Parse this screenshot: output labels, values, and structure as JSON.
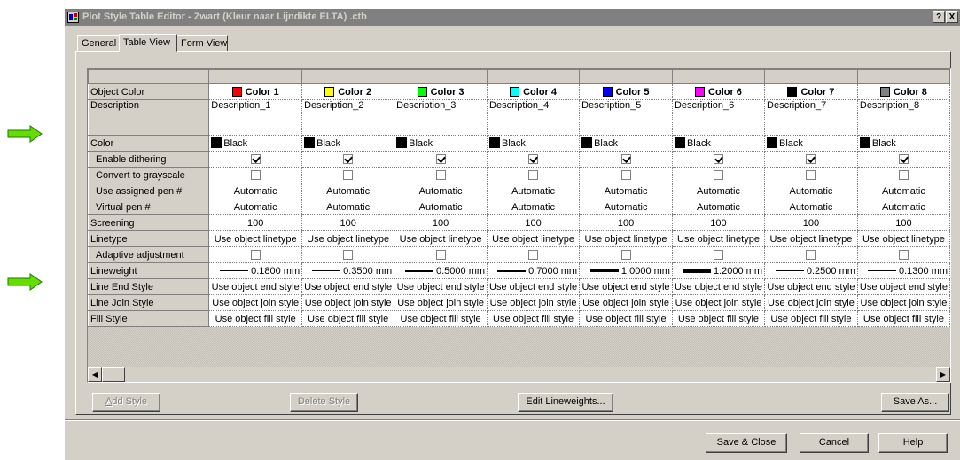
{
  "window": {
    "title": "Plot Style Table Editor - Zwart (Kleur naar Lijndikte ELTA) .ctb",
    "help_label": "?",
    "close_label": "X"
  },
  "tabs": [
    {
      "label": "General"
    },
    {
      "label": "Table View"
    },
    {
      "label": "Form View"
    }
  ],
  "columns": [
    {
      "name": "Color 1",
      "swatch": "#ff0000",
      "description": "Description_1"
    },
    {
      "name": "Color 2",
      "swatch": "#ffff00",
      "description": "Description_2"
    },
    {
      "name": "Color 3",
      "swatch": "#00ff00",
      "description": "Description_3"
    },
    {
      "name": "Color 4",
      "swatch": "#00ffff",
      "description": "Description_4"
    },
    {
      "name": "Color 5",
      "swatch": "#0000ff",
      "description": "Description_5"
    },
    {
      "name": "Color 6",
      "swatch": "#ff00ff",
      "description": "Description_6"
    },
    {
      "name": "Color 7",
      "swatch": "#000000",
      "description": "Description_7"
    },
    {
      "name": "Color 8",
      "swatch": "#808080",
      "description": "Description_8"
    }
  ],
  "row_labels": {
    "object_color": "Object Color",
    "description": "Description",
    "color": "Color",
    "enable_dithering": "Enable dithering",
    "convert_grayscale": "Convert to grayscale",
    "assigned_pen": "Use assigned pen #",
    "virtual_pen": "Virtual pen #",
    "screening": "Screening",
    "linetype": "Linetype",
    "adaptive": "Adaptive adjustment",
    "lineweight": "Lineweight",
    "line_end": "Line End Style",
    "line_join": "Line Join Style",
    "fill": "Fill Style"
  },
  "values": {
    "color": "Black",
    "color_swatch": "#000000",
    "enable_dithering": true,
    "convert_grayscale": false,
    "assigned_pen": "Automatic",
    "virtual_pen": "Automatic",
    "screening": "100",
    "linetype": "Use object linetype",
    "adaptive": false,
    "line_end": "Use object end style",
    "line_join": "Use object join style",
    "fill": "Use object fill style"
  },
  "lineweights": [
    "0.1800 mm",
    "0.3500 mm",
    "0.5000 mm",
    "0.7000 mm",
    "1.0000 mm",
    "1.2000 mm",
    "0.2500 mm",
    "0.1300 mm"
  ],
  "buttons": {
    "add_style": "Add Style",
    "delete_style": "Delete Style",
    "edit_lineweights": "Edit Lineweights...",
    "save_as": "Save As...",
    "save_close": "Save & Close",
    "cancel": "Cancel",
    "help": "Help"
  },
  "colors": {
    "arrow": "#66dd00",
    "dialog_bg": "#d4d0c8",
    "titlebar_inactive": "#808080"
  }
}
